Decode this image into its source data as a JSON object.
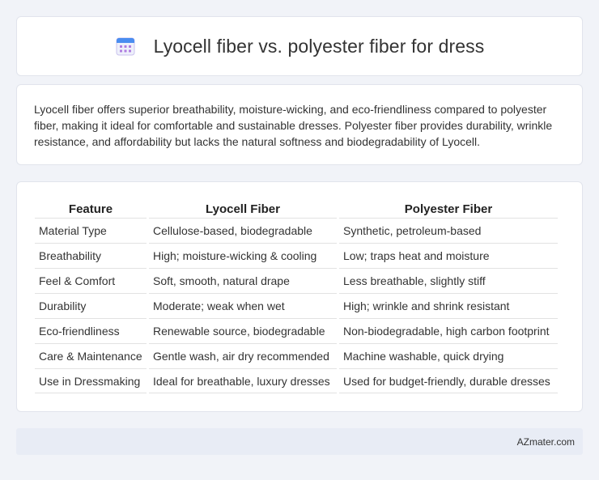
{
  "header": {
    "title": "Lyocell fiber vs. polyester fiber for dress",
    "icon": "calendar-icon",
    "icon_colors": {
      "top": "#4a8df0",
      "grid": "#b07de0"
    }
  },
  "summary": {
    "text": "Lyocell fiber offers superior breathability, moisture-wicking, and eco-friendliness compared to polyester fiber, making it ideal for comfortable and sustainable dresses. Polyester fiber provides durability, wrinkle resistance, and affordability but lacks the natural softness and biodegradability of Lyocell."
  },
  "table": {
    "headers": [
      "Feature",
      "Lyocell Fiber",
      "Polyester Fiber"
    ],
    "rows": [
      [
        "Material Type",
        "Cellulose-based, biodegradable",
        "Synthetic, petroleum-based"
      ],
      [
        "Breathability",
        "High; moisture-wicking & cooling",
        "Low; traps heat and moisture"
      ],
      [
        "Feel & Comfort",
        "Soft, smooth, natural drape",
        "Less breathable, slightly stiff"
      ],
      [
        "Durability",
        "Moderate; weak when wet",
        "High; wrinkle and shrink resistant"
      ],
      [
        "Eco-friendliness",
        "Renewable source, biodegradable",
        "Non-biodegradable, high carbon footprint"
      ],
      [
        "Care & Maintenance",
        "Gentle wash, air dry recommended",
        "Machine washable, quick drying"
      ],
      [
        "Use in Dressmaking",
        "Ideal for breathable, luxury dresses",
        "Used for budget-friendly, durable dresses"
      ]
    ]
  },
  "footer": {
    "brand": "AZmater.com"
  }
}
